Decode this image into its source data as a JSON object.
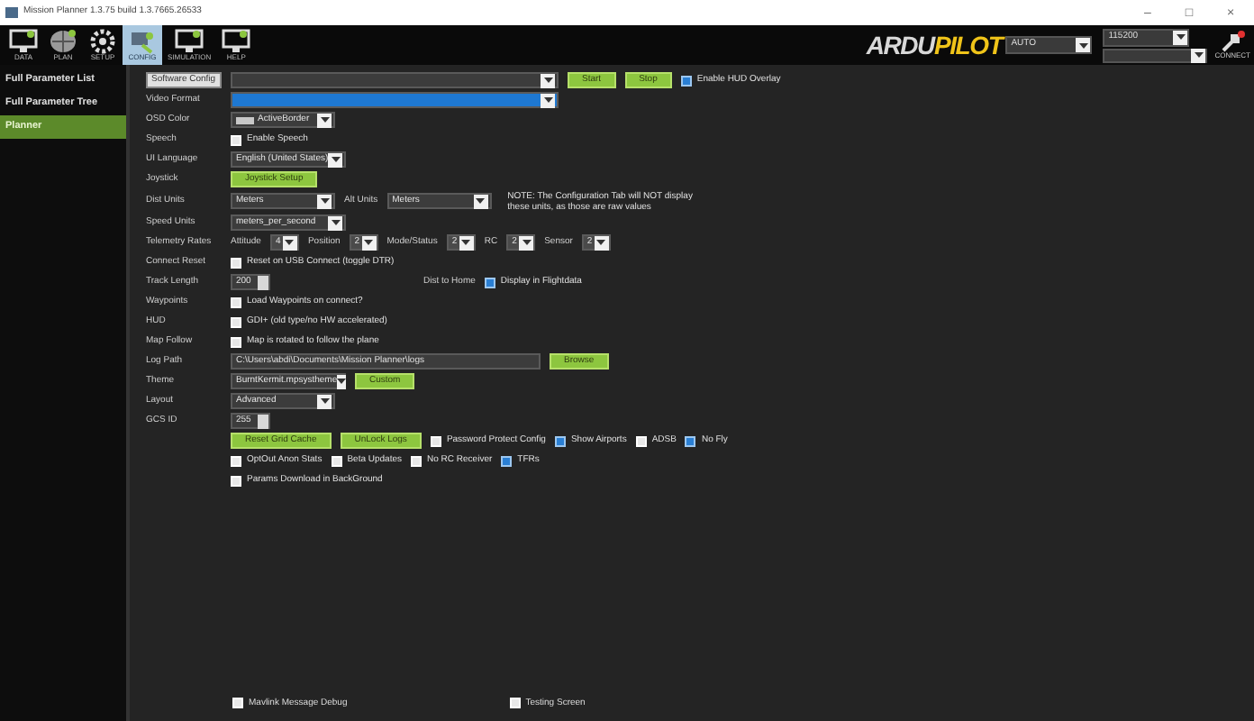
{
  "window": {
    "title": "Mission Planner 1.3.75 build 1.3.7665.26533",
    "controls": [
      "–",
      "□",
      "×"
    ]
  },
  "toolbar": {
    "items": [
      {
        "label": "DATA",
        "selected": false
      },
      {
        "label": "PLAN",
        "selected": false
      },
      {
        "label": "SETUP",
        "selected": false
      },
      {
        "label": "CONFIG",
        "selected": true
      },
      {
        "label": "SIMULATION",
        "selected": false
      },
      {
        "label": "HELP",
        "selected": false
      }
    ],
    "logo": {
      "first": "ARDU",
      "second": "PILOT"
    },
    "mode": "AUTO",
    "baud": "115200",
    "connect": "CONNECT"
  },
  "sidebar": {
    "items": [
      {
        "label": "Full Parameter List",
        "selected": false
      },
      {
        "label": "Full Parameter Tree",
        "selected": false
      },
      {
        "label": "Planner",
        "selected": true
      }
    ]
  },
  "tooltip": "Software Config",
  "rows": [
    {
      "controls": [
        {
          "kind": "wide_combo",
          "focused": false
        },
        {
          "kind": "button",
          "label": "Start"
        },
        {
          "kind": "button",
          "label": "Stop"
        },
        {
          "kind": "checkbox",
          "label": "Enable HUD Overlay",
          "checked": true
        }
      ]
    },
    {
      "label": "Video Format",
      "controls": [
        {
          "kind": "wide_combo",
          "focused": true
        }
      ]
    },
    {
      "label": "OSD Color",
      "controls": [
        {
          "kind": "color_combo",
          "value": "ActiveBorder",
          "focused": false
        }
      ]
    },
    {
      "label": "Speech",
      "controls": [
        {
          "kind": "checkbox",
          "label": "Enable Speech",
          "checked": false
        }
      ]
    },
    {
      "label": "UI Language",
      "controls": [
        {
          "kind": "combo",
          "value": "English (United States)",
          "focused": false
        }
      ]
    },
    {
      "label": "Joystick",
      "controls": [
        {
          "kind": "button",
          "label": "Joystick Setup"
        }
      ]
    },
    {
      "label": "Dist Units",
      "controls": [
        {
          "kind": "combo",
          "value": "Meters",
          "focused": false
        },
        {
          "kind": "text",
          "text": "Alt Units"
        },
        {
          "kind": "combo",
          "value": "Meters",
          "focused": false
        },
        {
          "kind": "note",
          "lines": [
            "NOTE: The Configuration Tab will NOT display",
            "these units, as those are raw values"
          ]
        }
      ]
    },
    {
      "label": "Speed Units",
      "controls": [
        {
          "kind": "combo",
          "value": "meters_per_second",
          "focused": false
        }
      ]
    },
    {
      "label": "Telemetry Rates",
      "controls": [
        {
          "kind": "text",
          "text": "Attitude"
        },
        {
          "kind": "mini",
          "value": "4"
        },
        {
          "kind": "text",
          "text": "Position"
        },
        {
          "kind": "mini",
          "value": "2"
        },
        {
          "kind": "text",
          "text": "Mode/Status"
        },
        {
          "kind": "mini",
          "value": "2"
        },
        {
          "kind": "text",
          "text": "RC"
        },
        {
          "kind": "mini",
          "value": "2"
        },
        {
          "kind": "text",
          "text": "Sensor"
        },
        {
          "kind": "mini",
          "value": "2"
        }
      ]
    },
    {
      "label": "Connect Reset",
      "controls": [
        {
          "kind": "checkbox",
          "label": "Reset on USB Connect (toggle DTR)",
          "checked": false
        }
      ]
    },
    {
      "label": "Track Length",
      "controls": [
        {
          "kind": "spin",
          "value": "200"
        },
        {
          "kind": "far_text",
          "text": "Dist to Home"
        },
        {
          "kind": "checkbox",
          "label": "Display in Flightdata",
          "checked": true
        }
      ]
    },
    {
      "label": "Waypoints",
      "controls": [
        {
          "kind": "checkbox",
          "label": "Load Waypoints on connect?",
          "checked": false
        }
      ]
    },
    {
      "label": "HUD",
      "controls": [
        {
          "kind": "checkbox",
          "label": "GDI+ (old type/no HW accelerated)",
          "checked": false
        }
      ]
    },
    {
      "label": "Map Follow",
      "controls": [
        {
          "kind": "checkbox",
          "label": "Map is rotated to follow the plane",
          "checked": false
        }
      ]
    },
    {
      "label": "Log Path",
      "controls": [
        {
          "kind": "field",
          "value": "C:\\Users\\abdi\\Documents\\Mission Planner\\logs"
        },
        {
          "kind": "button",
          "label": "Browse"
        }
      ]
    },
    {
      "label": "Theme",
      "controls": [
        {
          "kind": "combo",
          "value": "BurntKermit.mpsystheme",
          "focused": false
        },
        {
          "kind": "button",
          "label": "Custom"
        }
      ]
    },
    {
      "label": "Layout",
      "controls": [
        {
          "kind": "combo",
          "value": "Advanced",
          "focused": false
        }
      ]
    },
    {
      "label": "GCS ID",
      "controls": [
        {
          "kind": "spin",
          "value": "255"
        }
      ]
    },
    {
      "controls": [
        {
          "kind": "button",
          "label": "Reset Grid Cache"
        },
        {
          "kind": "button",
          "label": "UnLock Logs"
        },
        {
          "kind": "checkbox",
          "label": "Password Protect Config",
          "checked": false
        },
        {
          "kind": "checkbox",
          "label": "Show Airports",
          "checked": true
        },
        {
          "kind": "checkbox",
          "label": "ADSB",
          "checked": false
        },
        {
          "kind": "checkbox",
          "label": "No Fly",
          "checked": true
        }
      ]
    },
    {
      "controls": [
        {
          "kind": "checkbox",
          "label": "OptOut Anon Stats",
          "checked": false
        },
        {
          "kind": "checkbox",
          "label": "Beta Updates",
          "checked": false
        },
        {
          "kind": "checkbox",
          "label": "No RC Receiver",
          "checked": false
        },
        {
          "kind": "checkbox",
          "label": "TFRs",
          "checked": true
        }
      ]
    },
    {
      "controls": [
        {
          "kind": "checkbox",
          "label": "Params Download in BackGround",
          "checked": false
        }
      ]
    }
  ],
  "footer": [
    {
      "label": "Mavlink Message Debug",
      "checked": false
    },
    {
      "label": "Testing Screen",
      "checked": false
    }
  ]
}
